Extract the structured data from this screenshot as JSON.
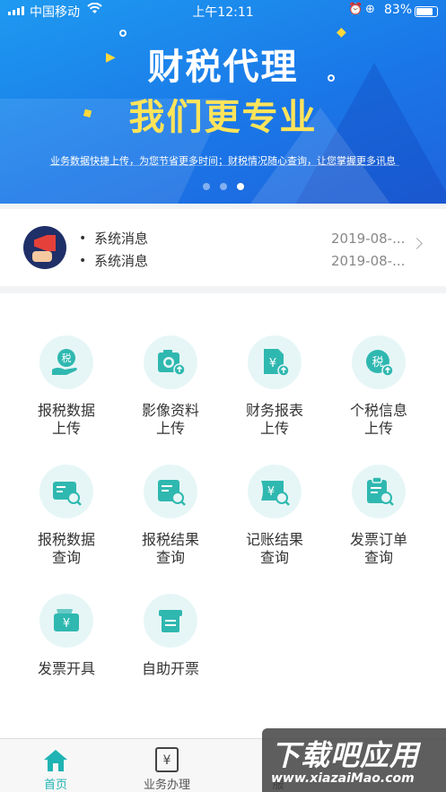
{
  "status_bar": {
    "carrier": "中国移动",
    "time": "上午12:11",
    "battery": "83%",
    "battery_level": 0.83
  },
  "banner": {
    "title": "财税代理",
    "subtitle": "我们更专业",
    "description": "业务数据快捷上传，为您节省更多时间；财税情况随心查询，让您掌握更多讯息",
    "slide_count": 3,
    "active_slide": 3
  },
  "notifications": {
    "items": [
      {
        "text": "系统消息",
        "date": "2019-08-..."
      },
      {
        "text": "系统消息",
        "date": "2019-08-..."
      }
    ],
    "bullet": "•"
  },
  "services": [
    {
      "line1": "报税数据",
      "line2": "上传",
      "icon": "tax-upload-icon"
    },
    {
      "line1": "影像资料",
      "line2": "上传",
      "icon": "camera-upload-icon"
    },
    {
      "line1": "财务报表",
      "line2": "上传",
      "icon": "report-upload-icon"
    },
    {
      "line1": "个税信息",
      "line2": "上传",
      "icon": "personal-tax-upload-icon"
    },
    {
      "line1": "报税数据",
      "line2": "查询",
      "icon": "tax-query-icon"
    },
    {
      "line1": "报税结果",
      "line2": "查询",
      "icon": "tax-result-query-icon"
    },
    {
      "line1": "记账结果",
      "line2": "查询",
      "icon": "bookkeeping-query-icon"
    },
    {
      "line1": "发票订单",
      "line2": "查询",
      "icon": "invoice-order-query-icon"
    },
    {
      "line1": "发票开具",
      "line2": "",
      "icon": "invoice-issue-icon"
    },
    {
      "line1": "自助开票",
      "line2": "",
      "icon": "self-invoice-icon"
    }
  ],
  "icon_glyphs": {
    "tax": "税",
    "yen": "¥"
  },
  "tabbar": {
    "items": [
      {
        "label": "首页",
        "icon": "home-icon",
        "active": true
      },
      {
        "label": "业务办理",
        "icon": "yen-document-icon",
        "active": false
      },
      {
        "label": "服",
        "icon": "service-icon",
        "active": false
      }
    ]
  },
  "watermark": {
    "brand": "下载吧应用",
    "url": "www.xiazaiMao.com"
  },
  "colors": {
    "accent": "#20b3b3",
    "banner_blue": "#1a78e8",
    "banner_yellow": "#ffe45a",
    "icon_bg": "#e6f6f6"
  }
}
